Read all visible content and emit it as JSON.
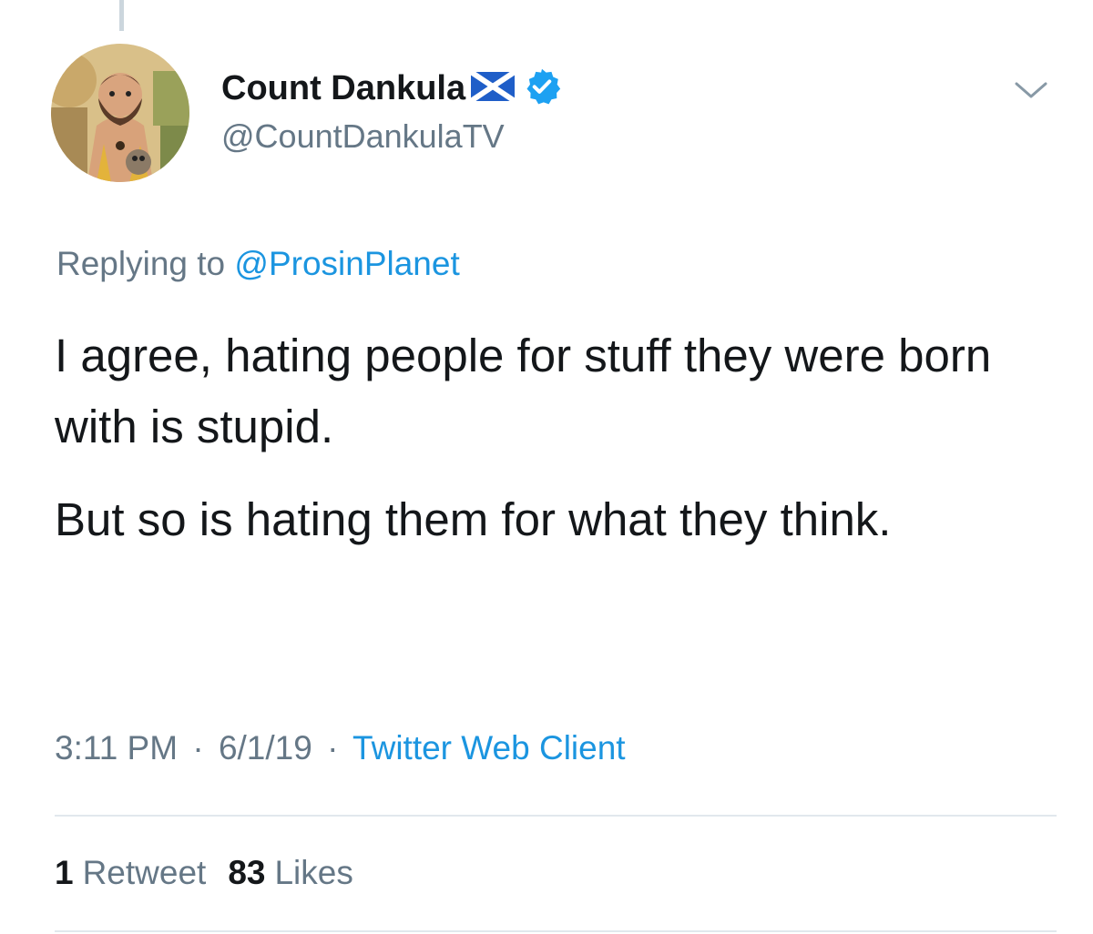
{
  "tweet": {
    "author": {
      "display_name": "Count Dankula",
      "handle": "@CountDankulaTV",
      "verified": true,
      "flag_icon": "scotland-flag-icon",
      "verified_icon": "verified-badge-icon"
    },
    "menu_icon": "chevron-down-icon",
    "reply": {
      "prefix": "Replying to",
      "mention": "@ProsinPlanet"
    },
    "paragraphs": [
      "I agree, hating people for stuff they were born with is stupid.",
      "But so is hating them for what they think."
    ],
    "meta": {
      "time": "3:11 PM",
      "date": "6/1/19",
      "separator": "·",
      "client": "Twitter Web Client"
    },
    "stats": {
      "retweets_count": "1",
      "retweets_label": "Retweet",
      "likes_count": "83",
      "likes_label": "Likes"
    }
  },
  "colors": {
    "text": "#14171a",
    "secondary": "#657786",
    "link": "#1b95e0",
    "verified": "#1da1f2",
    "divider": "#e1e8ed"
  }
}
